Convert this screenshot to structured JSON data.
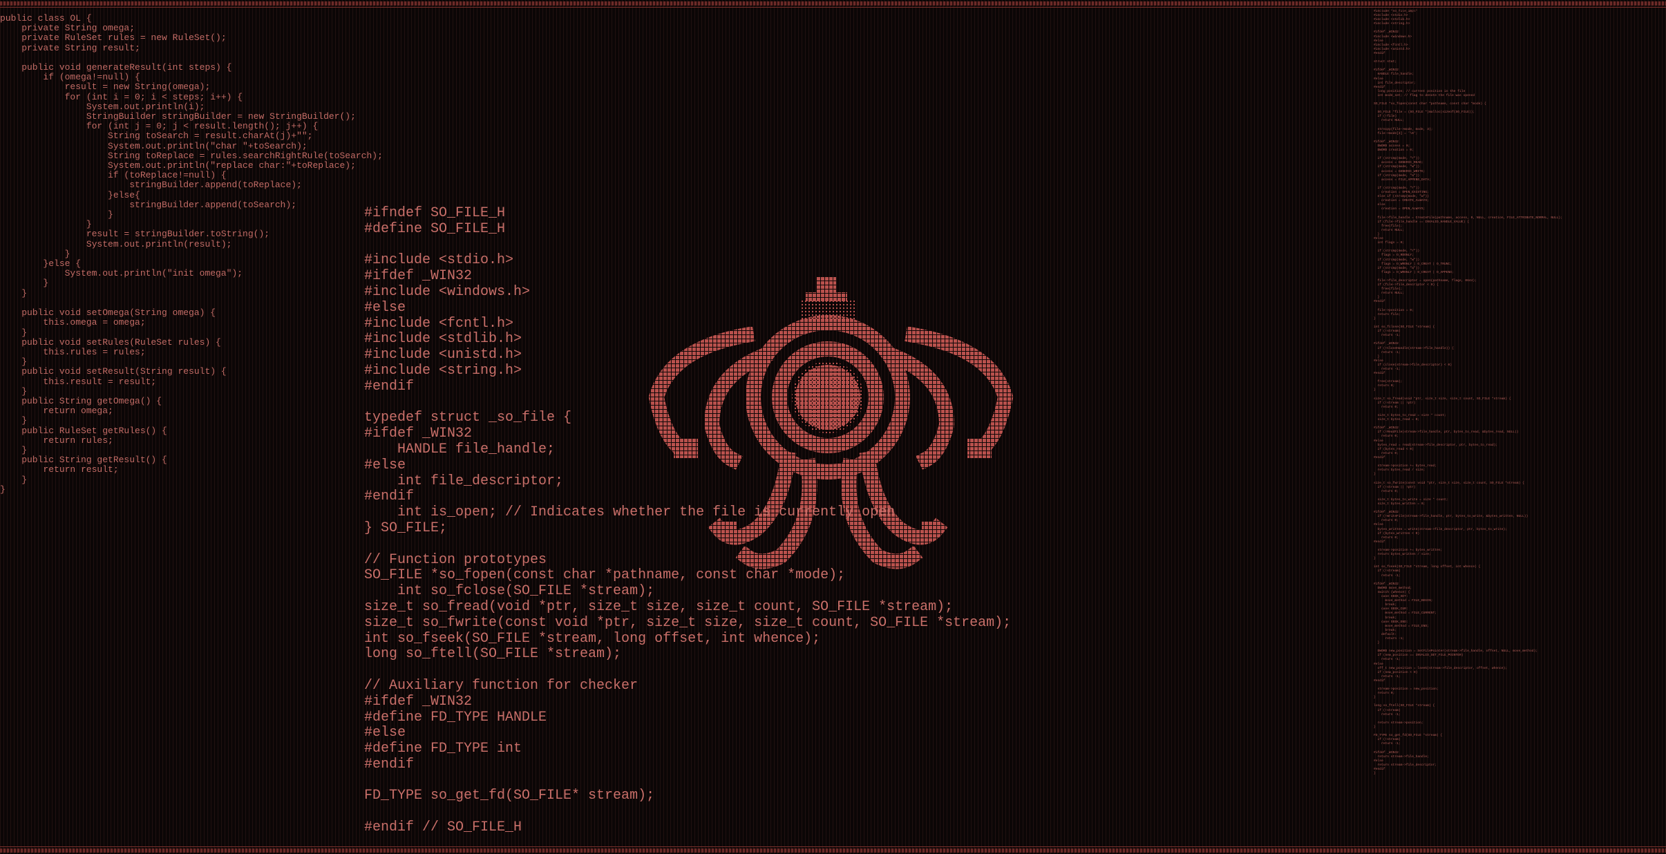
{
  "theme": {
    "background": "#0b0606",
    "accent": "#c96f69",
    "emblem_color": "#b9514d"
  },
  "java_panel": {
    "code": "public class OL {\n    private String omega;\n    private RuleSet rules = new RuleSet();\n    private String result;\n\n    public void generateResult(int steps) {\n        if (omega!=null) {\n            result = new String(omega);\n            for (int i = 0; i < steps; i++) {\n                System.out.println(i);\n                StringBuilder stringBuilder = new StringBuilder();\n                for (int j = 0; j < result.length(); j++) {\n                    String toSearch = result.charAt(j)+\"\";\n                    System.out.println(\"char \"+toSearch);\n                    String toReplace = rules.searchRightRule(toSearch);\n                    System.out.println(\"replace char:\"+toReplace);\n                    if (toReplace!=null) {\n                        stringBuilder.append(toReplace);\n                    }else{\n                        stringBuilder.append(toSearch);\n                    }\n                }\n                result = stringBuilder.toString();\n                System.out.println(result);\n            }\n        }else {\n            System.out.println(\"init omega\");\n        }\n    }\n\n    public void setOmega(String omega) {\n        this.omega = omega;\n    }\n    public void setRules(RuleSet rules) {\n        this.rules = rules;\n    }\n    public void setResult(String result) {\n        this.result = result;\n    }\n    public String getOmega() {\n        return omega;\n    }\n    public RuleSet getRules() {\n        return rules;\n    }\n    public String getResult() {\n        return result;\n    }\n}"
  },
  "c_panel": {
    "code": "#ifndef SO_FILE_H\n#define SO_FILE_H\n\n#include <stdio.h>\n#ifdef _WIN32\n#include <windows.h>\n#else\n#include <fcntl.h>\n#include <stdlib.h>\n#include <unistd.h>\n#include <string.h>\n#endif\n\ntypedef struct _so_file {\n#ifdef _WIN32\n    HANDLE file_handle;\n#else\n    int file_descriptor;\n#endif\n    int is_open; // Indicates whether the file is currently open\n} SO_FILE;\n\n// Function prototypes\nSO_FILE *so_fopen(const char *pathname, const char *mode);\n    int so_fclose(SO_FILE *stream);\nsize_t so_fread(void *ptr, size_t size, size_t count, SO_FILE *stream);\nsize_t so_fwrite(const void *ptr, size_t size, size_t count, SO_FILE *stream);\nint so_fseek(SO_FILE *stream, long offset, int whence);\nlong so_ftell(SO_FILE *stream);\n\n// Auxiliary function for checker\n#ifdef _WIN32\n#define FD_TYPE HANDLE\n#else\n#define FD_TYPE int\n#endif\n\nFD_TYPE so_get_fd(SO_FILE* stream);\n\n#endif // SO_FILE_H"
  },
  "mini_panel": {
    "code": "#include \"so_file_impl\"\n#include <stdio.h>\n#include <stdlib.h>\n#include <string.h>\n\n#ifdef _WIN32\n#include <windows.h>\n#else\n#include <fcntl.h>\n#include <unistd.h>\n#endif\n\nstruct stat;\n\n#ifdef _WIN32\n  HANDLE file_handle;\n#else\n  int file_descriptor;\n#endif\n  long position; // current position in the file\n  int mode_set; // flag to denote the file was opened\n\nSO_FILE *so_fopen(const char *pathname, const char *mode) {\n\n  SO_FILE *file = (SO_FILE *)malloc(sizeof(SO_FILE));\n  if (!file)\n    return NULL;\n\n  strncpy(file->mode, mode, 3);\n  file->mode[3] = '\\0';\n\n#ifdef _WIN32\n  DWORD access = 0;\n  DWORD creation = 0;\n\n  if (strcmp(mode, \"r\"))\n    access = GENERIC_READ;\n  if (strcmp(mode, \"w\"))\n    access = GENERIC_WRITE;\n  if (strcmp(mode, \"a\"))\n    access = FILE_APPEND_DATA;\n\n  if (strcmp(mode, \"r\"))\n    creation = OPEN_EXISTING;\n  else if (strcmp(mode, \"w\"))\n    creation = CREATE_ALWAYS;\n  else\n    creation = OPEN_ALWAYS;\n\n  file->file_handle = CreateFile(pathname, access, 0, NULL, creation, FILE_ATTRIBUTE_NORMAL, NULL);\n  if (file->file_handle == INVALID_HANDLE_VALUE) {\n    free(file);\n    return NULL;\n  }\n#else\n  int flags = 0;\n\n  if (strcmp(mode, \"r\"))\n    flags = O_RDONLY;\n  if (strcmp(mode, \"w\"))\n    flags = O_WRONLY | O_CREAT | O_TRUNC;\n  if (strcmp(mode, \"a\"))\n    flags = O_WRONLY | O_CREAT | O_APPEND;\n\n  file->file_descriptor = open(pathname, flags, 0644);\n  if (file->file_descriptor < 0) {\n    free(file);\n    return NULL;\n  }\n#endif\n\n  file->position = 0;\n  return file;\n}\n\nint so_fclose(SO_FILE *stream) {\n  if (!stream)\n    return -1;\n\n#ifdef _WIN32\n  if (!CloseHandle(stream->file_handle)) {\n    return -1;\n  }\n#else\n  if (close(stream->file_descriptor) < 0)\n    return -1;\n#endif\n\n  free(stream);\n  return 0;\n}\n\nsize_t so_fread(void *ptr, size_t size, size_t count, SO_FILE *stream) {\n  if (!stream || !ptr)\n    return 0;\n\n  size_t bytes_to_read = size * count;\n  size_t bytes_read = 0;\n\n#ifdef _WIN32\n  if (!ReadFile(stream->file_handle, ptr, bytes_to_read, &bytes_read, NULL))\n    return 0;\n#else\n  bytes_read = read(stream->file_descriptor, ptr, bytes_to_read);\n  if (bytes_read < 0)\n    return 0;\n#endif\n\n  stream->position += bytes_read;\n  return bytes_read / size;\n}\n\nsize_t so_fwrite(const void *ptr, size_t size, size_t count, SO_FILE *stream) {\n  if (!stream || !ptr)\n    return 0;\n\n  size_t bytes_to_write = size * count;\n  size_t bytes_written = 0;\n\n#ifdef _WIN32\n  if (!WriteFile(stream->file_handle, ptr, bytes_to_write, &bytes_written, NULL))\n    return 0;\n#else\n  bytes_written = write(stream->file_descriptor, ptr, bytes_to_write);\n  if (bytes_written < 0)\n    return 0;\n#endif\n\n  stream->position += bytes_written;\n  return bytes_written / size;\n}\n\nint so_fseek(SO_FILE *stream, long offset, int whence) {\n  if (!stream)\n    return -1;\n\n#ifdef _WIN32\n  DWORD move_method;\n  switch (whence) {\n    case SEEK_SET:\n      move_method = FILE_BEGIN;\n      break;\n    case SEEK_CUR:\n      move_method = FILE_CURRENT;\n      break;\n    case SEEK_END:\n      move_method = FILE_END;\n      break;\n    default:\n      return -1;\n  }\n\n  DWORD new_position = SetFilePointer(stream->file_handle, offset, NULL, move_method);\n  if (new_position == INVALID_SET_FILE_POINTER)\n    return -1;\n#else\n  off_t new_position = lseek(stream->file_descriptor, offset, whence);\n  if (new_position < 0)\n    return -1;\n#endif\n\n  stream->position = new_position;\n  return 0;\n}\n\nlong so_ftell(SO_FILE *stream) {\n  if (!stream)\n    return -1;\n\n  return stream->position;\n}\n\nFD_TYPE so_get_fd(SO_FILE *stream) {\n  if (!stream)\n    return -1;\n\n#ifdef _WIN32\n  return stream->file_handle;\n#else\n  return stream->file_descriptor;\n#endif\n}"
  }
}
